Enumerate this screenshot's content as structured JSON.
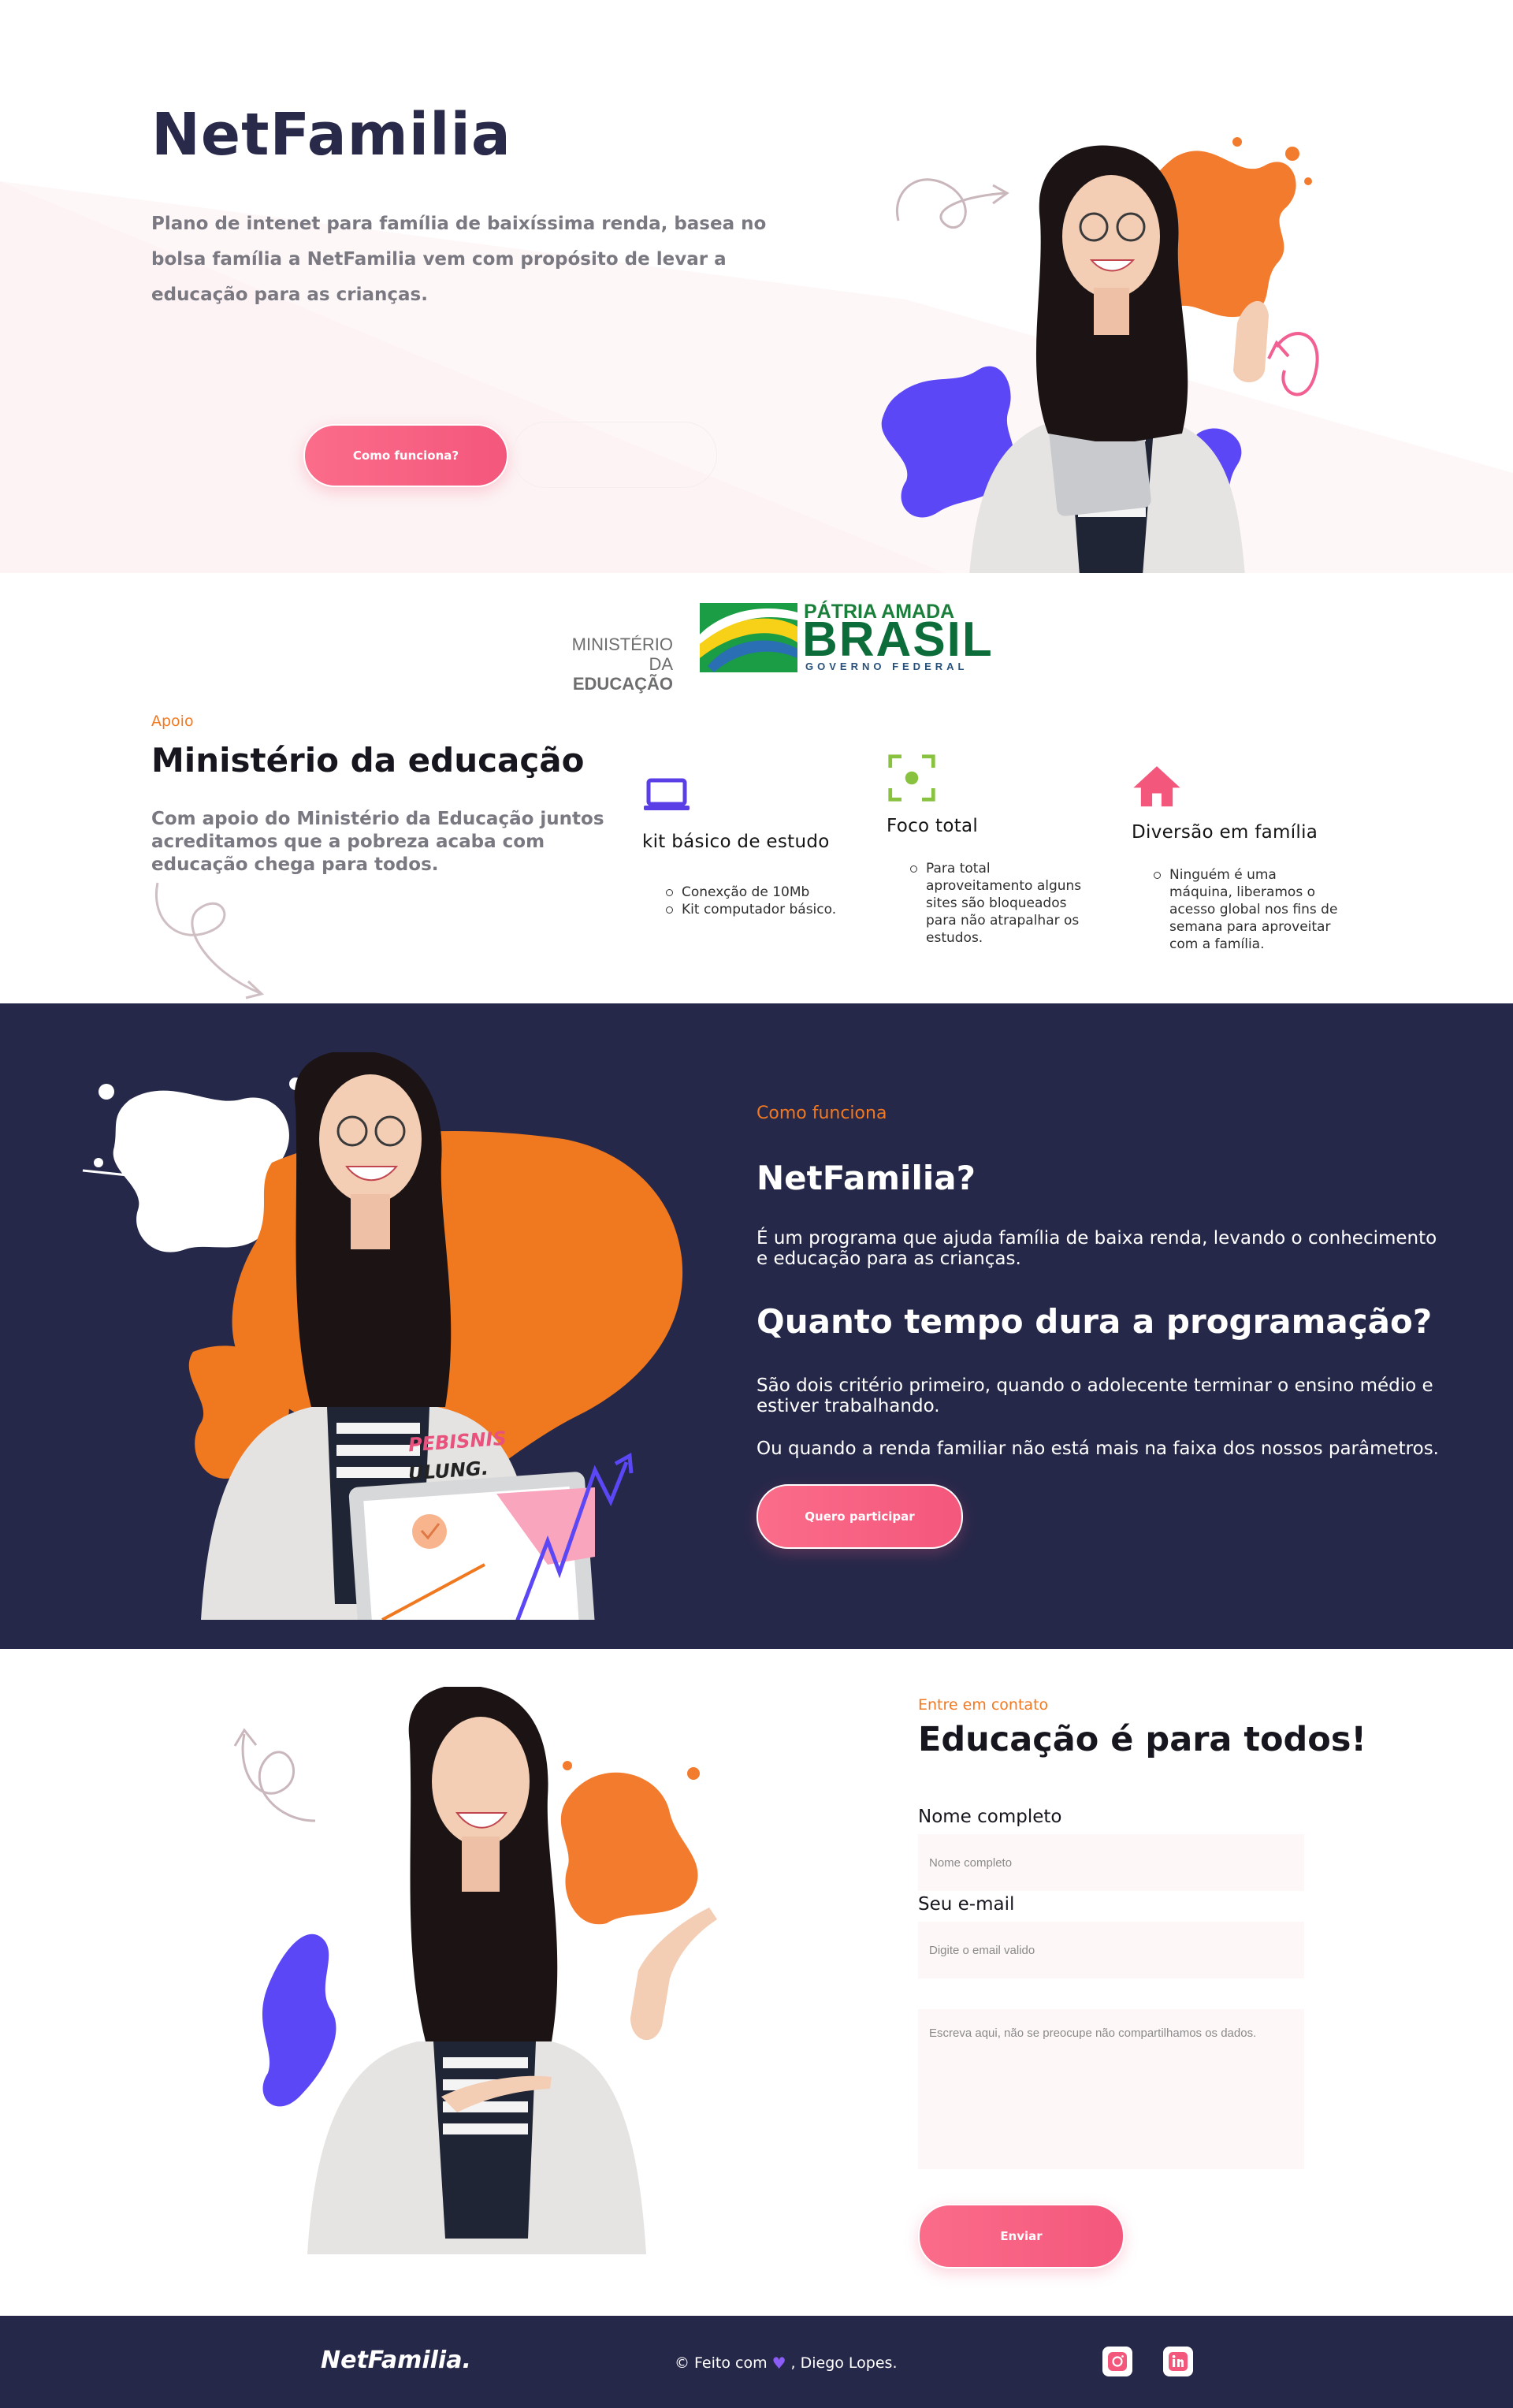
{
  "hero": {
    "title": "NetFamilia",
    "description": "Plano de intenet para família de baixíssima renda, basea no bolsa família a NetFamilia vem com propósito de levar a educação para as crianças.",
    "cta_label": "Como funciona?"
  },
  "logos": {
    "ministerio_line1": "MINISTÉRIO DA",
    "ministerio_line2": "EDUCAÇÃO",
    "patria_amada": "PÁTRIA AMADA",
    "brasil": "BRASIL",
    "governo_federal": "GOVERNO FEDERAL"
  },
  "support": {
    "kicker": "Apoio",
    "title": "Ministério da educação",
    "text": "Com apoio do Ministério da Educação juntos acreditamos que a pobreza acaba com educação chega para todos.",
    "features": [
      {
        "icon": "laptop-icon",
        "title": "kit básico de estudo",
        "items": [
          "Conexção de 10Mb",
          "Kit computador básico."
        ]
      },
      {
        "icon": "focus-target-icon",
        "title": "Foco total",
        "items": [
          "Para total aproveitamento alguns sites são bloqueados para não atrapalhar os estudos."
        ]
      },
      {
        "icon": "home-icon",
        "title": "Diversão em família",
        "items": [
          "Ninguém é uma máquina, liberamos o acesso global nos fins de semana para aproveitar com a família."
        ]
      }
    ]
  },
  "how": {
    "kicker": "Como funciona",
    "title": "NetFamilia?",
    "text1": "É um programa que ajuda família de baixa renda, levando o conhecimento e educação para as crianças.",
    "title2": "Quanto tempo dura a programação?",
    "text2": "São dois critério primeiro, quando o adolecente terminar o ensino médio e estiver trabalhando.",
    "text3": "Ou quando a renda familiar não está mais na faixa dos nossos parâmetros.",
    "cta_label": "Quero participar",
    "laptop_text1": "PEBISNIS",
    "laptop_text2": "ULUNG."
  },
  "contact": {
    "kicker": "Entre em contato",
    "title": "Educação é para todos!",
    "name_label": "Nome completo",
    "name_placeholder": "Nome completo",
    "email_label": "Seu e-mail",
    "email_placeholder": "Digite o email valido",
    "message_placeholder": "Escreva aqui, não se preocupe não compartilhamos os dados.",
    "submit_label": "Enviar"
  },
  "footer": {
    "logo": "NetFamilia.",
    "credit_prefix": "© Feito com",
    "credit_suffix": ", Diego Lopes.",
    "social": [
      "instagram-icon",
      "linkedin-icon"
    ]
  },
  "colors": {
    "navy": "#26284a",
    "accent_pink": "#f4577c",
    "accent_orange": "#f27920",
    "accent_purple": "#5b47f5"
  }
}
